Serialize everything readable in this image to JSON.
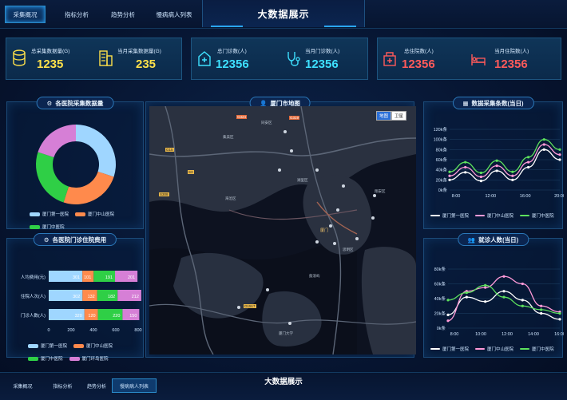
{
  "nav": {
    "tabs": [
      {
        "label": "采集概况",
        "active": true
      },
      {
        "label": "指标分析",
        "active": false
      },
      {
        "label": "趋势分析",
        "active": false
      },
      {
        "label": "慢病病人列表",
        "active": false
      }
    ],
    "title": "大数据展示"
  },
  "stats": [
    {
      "label": "总采集数据量(G)",
      "value": "1235",
      "icon": "database-icon",
      "color": "#ffe14a"
    },
    {
      "label": "当月采集数据量(G)",
      "value": "235",
      "icon": "building-icon",
      "color": "#ffe14a"
    },
    {
      "label": "总门诊数(人)",
      "value": "12356",
      "icon": "hospital-icon",
      "color": "#3ee0ff"
    },
    {
      "label": "当月门诊数(人)",
      "value": "12356",
      "icon": "stethoscope-icon",
      "color": "#3ee0ff"
    },
    {
      "label": "总住院数(人)",
      "value": "12356",
      "icon": "ward-icon",
      "color": "#ff5a5a"
    },
    {
      "label": "当月住院数(人)",
      "value": "12356",
      "icon": "bed-icon",
      "color": "#ff5a5a"
    }
  ],
  "panels": {
    "donut_title": "各医院采集数据量",
    "bar_title": "各医院门诊住院费用",
    "map_title": "厦门市地图",
    "line1_title": "数据采集条数(当日)",
    "line2_title": "就诊人数(当日)"
  },
  "map": {
    "toggle": [
      "地图",
      "卫星"
    ],
    "places": [
      "海沧区",
      "湖里区",
      "思明区",
      "集美区",
      "厦门大学",
      "厦门",
      "翔安区",
      "同安区",
      "鼓浪屿"
    ],
    "roads": [
      "G15",
      "G324",
      "S308",
      "G319",
      "S3",
      "G1517"
    ]
  },
  "chart_data": [
    {
      "type": "pie",
      "title": "各医院采集数据量",
      "labels": [
        "厦门第一医院",
        "厦门中山医院",
        "厦门中医院",
        "厦门环岛医院"
      ],
      "values": [
        30,
        25,
        25,
        20
      ],
      "colors": [
        "#9fd6ff",
        "#ff8a4c",
        "#2fcf46",
        "#d67fd6"
      ],
      "donut": true
    },
    {
      "type": "bar",
      "orientation": "horizontal",
      "stacked": true,
      "title": "各医院门诊住院费用",
      "categories": [
        "人均费用(元)",
        "住院人次(人)",
        "门诊人数(人)"
      ],
      "series": [
        {
          "name": "厦门第一医院",
          "values": [
            301,
            302,
            320
          ],
          "color": "#9fd6ff"
        },
        {
          "name": "厦门中山医院",
          "values": [
            101,
            132,
            120
          ],
          "color": "#ff8a4c"
        },
        {
          "name": "厦门中医院",
          "values": [
            191,
            182,
            220
          ],
          "color": "#2fcf46"
        },
        {
          "name": "厦门环岛医院",
          "values": [
            201,
            212,
            150
          ],
          "color": "#d67fd6"
        }
      ],
      "xticks": [
        "0",
        "200",
        "400",
        "600",
        "800"
      ],
      "xlim": [
        0,
        800
      ]
    },
    {
      "type": "line",
      "title": "数据采集条数(当日)",
      "x": [
        "8:00",
        "12:00",
        "16:00",
        "20:00"
      ],
      "yticks": [
        "0k条",
        "20k条",
        "40k条",
        "60k条",
        "80k条",
        "100k条",
        "120k条"
      ],
      "ylim": [
        0,
        120
      ],
      "series": [
        {
          "name": "厦门第一医院",
          "values": [
            20,
            35,
            18,
            38,
            20,
            45,
            80,
            60
          ],
          "color": "#ffffff"
        },
        {
          "name": "厦门中山医院",
          "values": [
            28,
            45,
            26,
            48,
            28,
            55,
            90,
            70
          ],
          "color": "#ff9ad8"
        },
        {
          "name": "厦门中医院",
          "values": [
            36,
            55,
            34,
            58,
            36,
            65,
            100,
            80
          ],
          "color": "#5de15d"
        }
      ],
      "legend": [
        "厦门第一医院",
        "厦门中山医院",
        "厦门中医院"
      ]
    },
    {
      "type": "line",
      "title": "就诊人数(当日)",
      "x": [
        "8:00",
        "10:00",
        "12:00",
        "14:00",
        "16:00"
      ],
      "yticks": [
        "0k条",
        "20k条",
        "40k条",
        "60k条",
        "80k条"
      ],
      "ylim": [
        0,
        80
      ],
      "series": [
        {
          "name": "厦门第一医院",
          "values": [
            18,
            42,
            36,
            50,
            38,
            20,
            12
          ],
          "color": "#ffffff"
        },
        {
          "name": "厦门中山医院",
          "values": [
            10,
            50,
            55,
            70,
            60,
            30,
            22
          ],
          "color": "#ff9ad8"
        },
        {
          "name": "厦门中医院",
          "values": [
            38,
            48,
            58,
            42,
            30,
            25,
            20
          ],
          "color": "#5de15d"
        }
      ],
      "legend": [
        "厦门第一医院",
        "厦门中山医院",
        "厦门中医院"
      ]
    }
  ],
  "bottom": {
    "tabs": [
      {
        "label": "采集概况",
        "active": false
      },
      {
        "label": "指标分析",
        "active": false
      },
      {
        "label": "趋势分析",
        "active": false
      },
      {
        "label": "慢病病人列表",
        "active": true
      }
    ],
    "title": "大数据展示"
  }
}
